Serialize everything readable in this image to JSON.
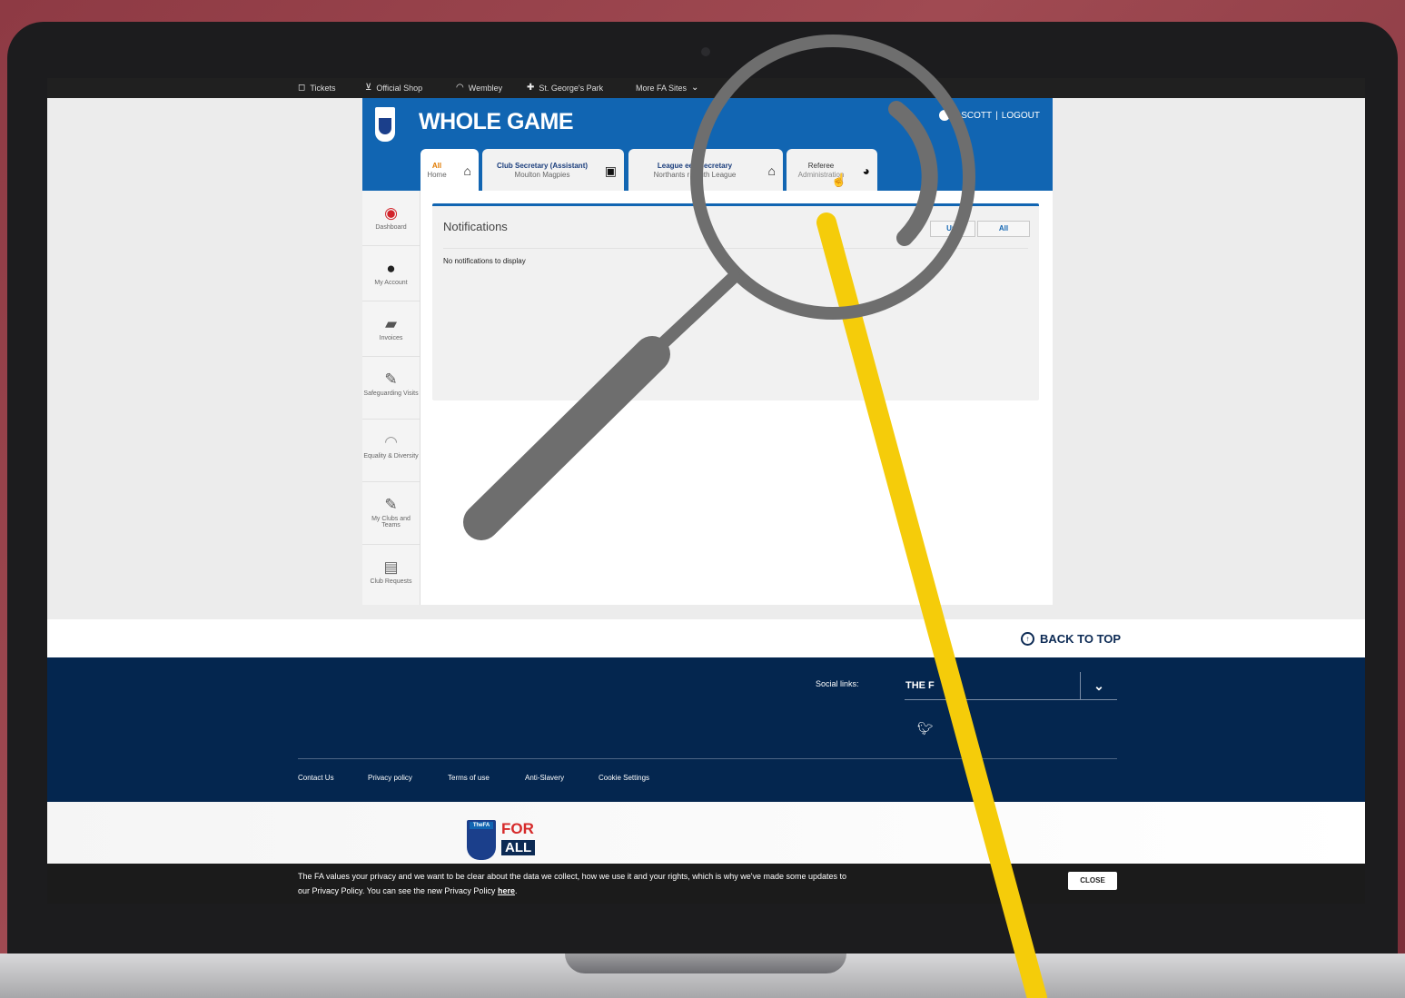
{
  "topbar": {
    "items": [
      {
        "label": "Tickets",
        "icon": "ticket-icon"
      },
      {
        "label": "Official Shop",
        "icon": "cart-icon"
      },
      {
        "label": "Wembley",
        "icon": "wembley-arch-icon"
      },
      {
        "label": "St. George's Park",
        "icon": "cross-icon"
      },
      {
        "label": "More FA Sites",
        "icon": "chevron-down-icon"
      }
    ]
  },
  "header": {
    "title": "WHOLE GAME",
    "user_name": "L    SCOTT",
    "separator": "|",
    "logout": "LOGOUT"
  },
  "tabs": [
    {
      "line1": "All",
      "line2": "Home",
      "icon": "home-icon"
    },
    {
      "line1": "Club Secretary (Assistant)",
      "line2": "Moulton Magpies",
      "icon": "club-badge-icon"
    },
    {
      "line1": "League      ees Secretary",
      "line2": "Northants    r Youth League",
      "icon": "home-icon"
    },
    {
      "line1": "Referee",
      "line2": "Administration",
      "icon": "whistle-icon"
    }
  ],
  "sidebar": {
    "items": [
      {
        "label": "Dashboard",
        "icon": "dashboard-icon"
      },
      {
        "label": "My Account",
        "icon": "user-icon"
      },
      {
        "label": "Invoices",
        "icon": "invoice-icon"
      },
      {
        "label": "Safeguarding Visits",
        "icon": "pencil-icon"
      },
      {
        "label": "Equality & Diversity",
        "icon": "rainbow-icon"
      },
      {
        "label": "My Clubs and Teams",
        "icon": "pencil-icon"
      },
      {
        "label": "Club Requests",
        "icon": "document-icon"
      }
    ]
  },
  "notifications": {
    "title": "Notifications",
    "filter_unread": "Unr",
    "filter_all": "All",
    "empty_message": "No notifications to display"
  },
  "footer": {
    "back_to_top": "BACK TO TOP",
    "social_label": "Social links:",
    "social_selected": "THE F",
    "links": [
      "Contact Us",
      "Privacy policy",
      "Terms of use",
      "Anti-Slavery",
      "Cookie Settings"
    ],
    "fa_tag": "TheFA",
    "for_word": "FOR",
    "all_word": "ALL"
  },
  "cookie_banner": {
    "text_line1": "The FA values your privacy and we want to be clear about the data we collect, how we use it and your rights, which is why we've made some updates to",
    "text_line2": "our Privacy Policy. You can see the new Privacy Policy",
    "link": "here",
    "period": ".",
    "close": "CLOSE"
  },
  "colors": {
    "header_blue": "#1165b2",
    "footer_navy": "#04264f",
    "highlight_yellow": "#f5cc0a",
    "magnifier_grey": "#6e6e6e"
  }
}
